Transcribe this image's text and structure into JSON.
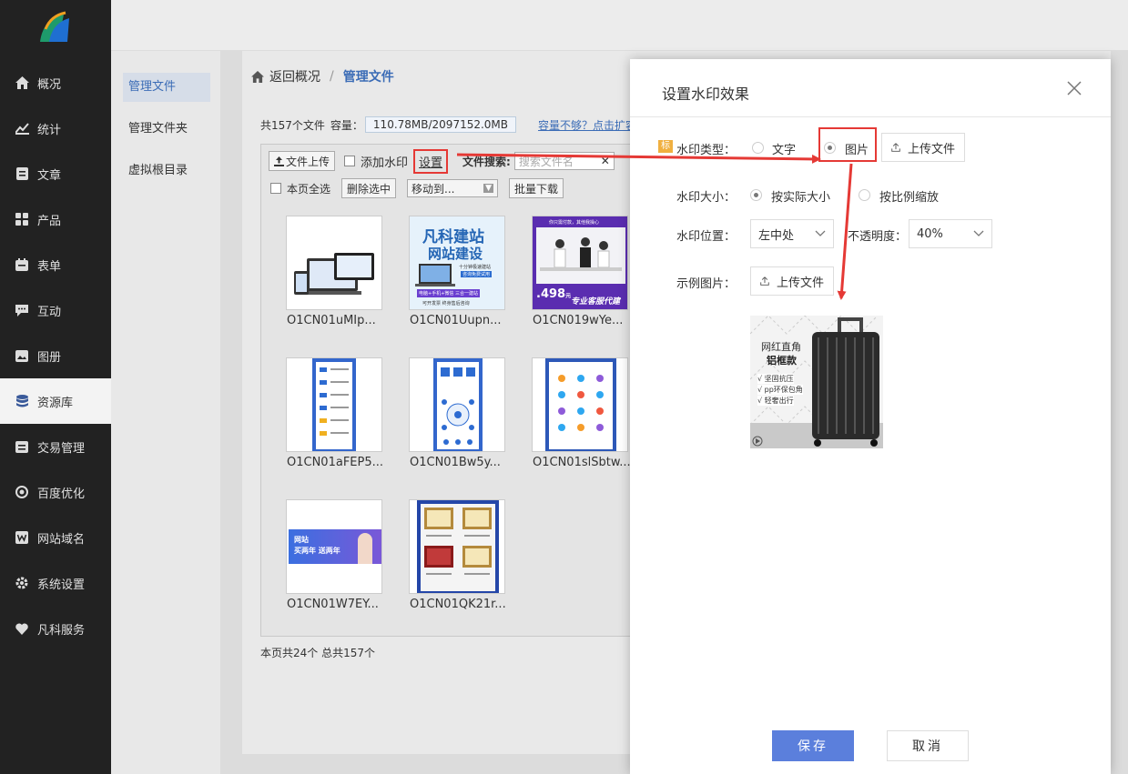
{
  "nav": {
    "items": [
      {
        "label": "概况",
        "icon": "home-icon"
      },
      {
        "label": "统计",
        "icon": "chart-icon"
      },
      {
        "label": "文章",
        "icon": "article-icon"
      },
      {
        "label": "产品",
        "icon": "grid-icon"
      },
      {
        "label": "表单",
        "icon": "calendar-icon"
      },
      {
        "label": "互动",
        "icon": "chat-icon"
      },
      {
        "label": "图册",
        "icon": "image-icon"
      },
      {
        "label": "资源库",
        "icon": "database-icon"
      },
      {
        "label": "交易管理",
        "icon": "order-icon"
      },
      {
        "label": "百度优化",
        "icon": "seo-icon"
      },
      {
        "label": "网站域名",
        "icon": "w-icon"
      },
      {
        "label": "系统设置",
        "icon": "gear-icon"
      },
      {
        "label": "凡科服务",
        "icon": "heart-icon"
      }
    ],
    "active_index": 7
  },
  "subnav": {
    "items": [
      "管理文件",
      "管理文件夹",
      "虚拟根目录"
    ],
    "active_index": 0
  },
  "breadcrumb": {
    "back": "返回概况",
    "separator": "/",
    "current": "管理文件"
  },
  "stats": {
    "total": "共157个文件",
    "cap_label": "容量：",
    "cap_value": "110.78MB/2097152.0MB",
    "expand_link": "容量不够？点击扩容"
  },
  "toolbar": {
    "upload": "文件上传",
    "add_watermark": "添加水印",
    "settings": "设置",
    "search_label": "文件搜索:",
    "search_placeholder": "搜索文件名",
    "select_all": "本页全选",
    "delete_selected": "删除选中",
    "move_to": "移动到...",
    "batch_download": "批量下载"
  },
  "files": [
    {
      "name": "O1CN01uMIp..."
    },
    {
      "name": "O1CN01Uupn..."
    },
    {
      "name": "O1CN019wYe..."
    },
    {
      "name": "O1CN01aFEP5..."
    },
    {
      "name": "O1CN01Bw5y..."
    },
    {
      "name": "O1CN01slSbtw..."
    },
    {
      "name": "O1CN01W7EY..."
    },
    {
      "name": "O1CN01QK21r..."
    }
  ],
  "thumb_texts": {
    "site_title": "凡科建站",
    "site_sub": "网站建设",
    "site_note": "十分钟极速建站",
    "site_note2": "咨询免费试用",
    "site_bar": "电脑+手机+微信 三合一建站",
    "site_bottom": "可开发票  终身售后咨询",
    "service_top": "你只需付款，其他我操心",
    "service_price": ".498",
    "service_unit": "元",
    "service_bottom": "专业客服代建",
    "banner_text1": "网站",
    "banner_text2": "买两年 送两年"
  },
  "pageinfo": "本页共24个 总共157个",
  "modal": {
    "title": "设置水印效果",
    "tag": "标",
    "type_label": "水印类型：",
    "type_text": "文字",
    "type_image": "图片",
    "upload_file": "上传文件",
    "size_label": "水印大小：",
    "size_actual": "按实际大小",
    "size_ratio": "按比例缩放",
    "pos_label": "水印位置：",
    "pos_value": "左中处",
    "opacity_label": "不透明度：",
    "opacity_value": "40%",
    "sample_label": "示例图片：",
    "sample_upload": "上传文件",
    "sample_text1": "网红直角",
    "sample_text2": "铝框款",
    "sample_f1": "√ 坚固抗压",
    "sample_f2": "√ pp环保包角",
    "sample_f3": "√ 轻奢出行",
    "save": "保存",
    "cancel": "取消"
  },
  "colors": {
    "accent": "#5b7fdc",
    "link": "#3b6cb6",
    "highlight": "#e53935",
    "nav_bg": "#222222"
  }
}
